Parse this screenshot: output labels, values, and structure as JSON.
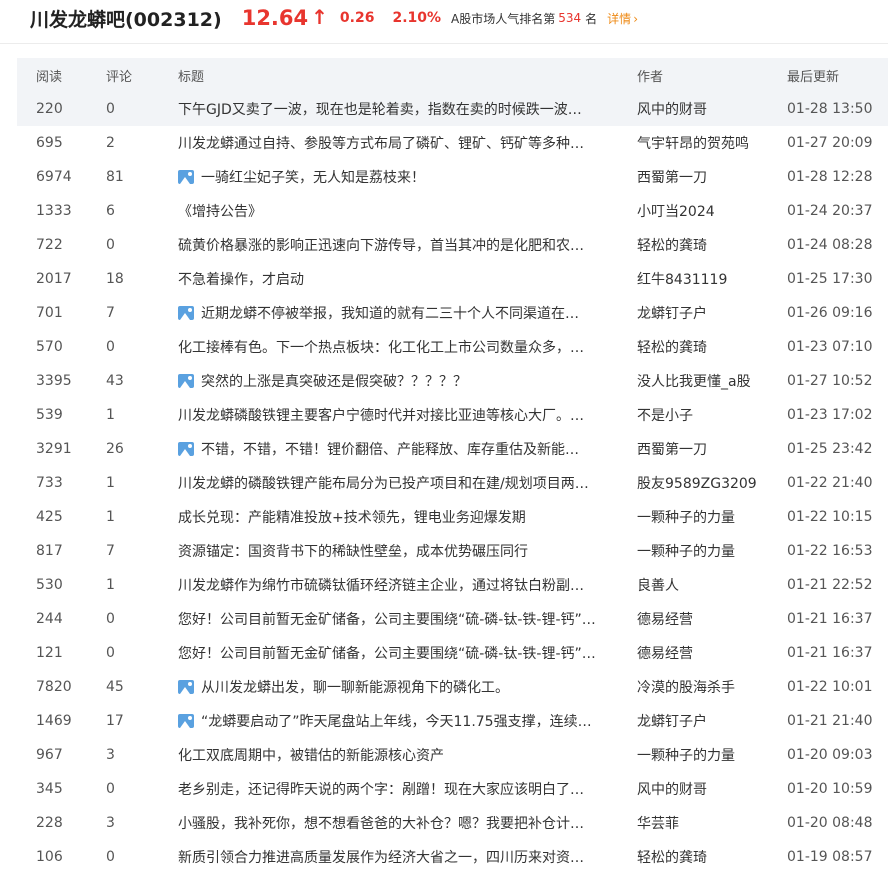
{
  "header": {
    "bar_name": "川发龙蟒吧(002312)",
    "price": "12.64",
    "arrow": "↑",
    "change": "0.26",
    "change_pct": "2.10%",
    "rank_label": "A股市场人气排名第",
    "rank_num": "534",
    "rank_unit": "名",
    "detail": "详情",
    "detail_arrow": "›"
  },
  "columns": {
    "read": "阅读",
    "comments": "评论",
    "title": "标题",
    "author": "作者",
    "updated": "最后更新"
  },
  "posts": [
    {
      "read": "220",
      "comments": "0",
      "img": false,
      "title": "下午GJD又卖了一波，现在也是轮着卖，指数在卖的时候跌一波…",
      "author": "风中的财哥",
      "time": "01-28 13:50"
    },
    {
      "read": "695",
      "comments": "2",
      "img": false,
      "title": "川发龙蟒通过自持、参股等方式布局了磷矿、锂矿、钙矿等多种…",
      "author": "气宇轩昂的贺苑鸣",
      "time": "01-27 20:09"
    },
    {
      "read": "6974",
      "comments": "81",
      "img": true,
      "title": "一骑红尘妃子笑，无人知是荔枝来！",
      "author": "西蜀第一刀",
      "time": "01-28 12:28"
    },
    {
      "read": "1333",
      "comments": "6",
      "img": false,
      "title": "《增持公告》",
      "author": "小叮当2024",
      "time": "01-24 20:37"
    },
    {
      "read": "722",
      "comments": "0",
      "img": false,
      "title": "硫黄价格暴涨的影响正迅速向下游传导，首当其冲的是化肥和农…",
      "author": "轻松的龚琦",
      "time": "01-24 08:28"
    },
    {
      "read": "2017",
      "comments": "18",
      "img": false,
      "title": "不急着操作，才启动",
      "author": "红牛8431119",
      "time": "01-25 17:30"
    },
    {
      "read": "701",
      "comments": "7",
      "img": true,
      "title": "近期龙蟒不停被举报，我知道的就有二三十个人不同渠道在…",
      "author": "龙蟒钉子户",
      "time": "01-26 09:16"
    },
    {
      "read": "570",
      "comments": "0",
      "img": false,
      "title": "化工接棒有色。下一个热点板块：化工化工上市公司数量众多，…",
      "author": "轻松的龚琦",
      "time": "01-23 07:10"
    },
    {
      "read": "3395",
      "comments": "43",
      "img": true,
      "title": "突然的上涨是真突破还是假突破？？？？？",
      "author": "没人比我更懂_a股",
      "time": "01-27 10:52"
    },
    {
      "read": "539",
      "comments": "1",
      "img": false,
      "title": "川发龙蟒磷酸铁锂主要客户宁德时代并对接比亚迪等核心大厂。…",
      "author": "不是小子",
      "time": "01-23 17:02"
    },
    {
      "read": "3291",
      "comments": "26",
      "img": true,
      "title": "不错，不错，不错！锂价翻倍、产能释放、库存重估及新能…",
      "author": "西蜀第一刀",
      "time": "01-25 23:42"
    },
    {
      "read": "733",
      "comments": "1",
      "img": false,
      "title": "川发龙蟒的磷酸铁锂产能布局分为已投产项目和在建/规划项目两…",
      "author": "股友9589ZG3209",
      "time": "01-22 21:40"
    },
    {
      "read": "425",
      "comments": "1",
      "img": false,
      "title": "成长兑现：产能精准投放+技术领先，锂电业务迎爆发期",
      "author": "一颗种子的力量",
      "time": "01-22 10:15"
    },
    {
      "read": "817",
      "comments": "7",
      "img": false,
      "title": "资源锚定：国资背书下的稀缺性壁垒，成本优势碾压同行",
      "author": "一颗种子的力量",
      "time": "01-22 16:53"
    },
    {
      "read": "530",
      "comments": "1",
      "img": false,
      "title": "川发龙蟒作为绵竹市硫磷钛循环经济链主企业，通过将钛白粉副…",
      "author": "良善人",
      "time": "01-21 22:52"
    },
    {
      "read": "244",
      "comments": "0",
      "img": false,
      "title": "您好！公司目前暂无金矿储备，公司主要围绕“硫-磷-钛-铁-锂-钙”…",
      "author": "德易经营",
      "time": "01-21 16:37"
    },
    {
      "read": "121",
      "comments": "0",
      "img": false,
      "title": "您好！公司目前暂无金矿储备，公司主要围绕“硫-磷-钛-铁-锂-钙”…",
      "author": "德易经营",
      "time": "01-21 16:37"
    },
    {
      "read": "7820",
      "comments": "45",
      "img": true,
      "title": "从川发龙蟒出发，聊一聊新能源视角下的磷化工。",
      "author": "冷漠的股海杀手",
      "time": "01-22 10:01"
    },
    {
      "read": "1469",
      "comments": "17",
      "img": true,
      "title": "“龙蟒要启动了”昨天尾盘站上年线，今天11.75强支撑，连续…",
      "author": "龙蟒钉子户",
      "time": "01-21 21:40"
    },
    {
      "read": "967",
      "comments": "3",
      "img": false,
      "title": "化工双底周期中，被错估的新能源核心资产",
      "author": "一颗种子的力量",
      "time": "01-20 09:03"
    },
    {
      "read": "345",
      "comments": "0",
      "img": false,
      "title": "老乡别走，还记得昨天说的两个字：剐蹭！现在大家应该明白了…",
      "author": "风中的财哥",
      "time": "01-20 10:59"
    },
    {
      "read": "228",
      "comments": "3",
      "img": false,
      "title": "小骚股，我补死你，想不想看爸爸的大补仓？嗯？我要把补仓计…",
      "author": "华芸菲",
      "time": "01-20 08:48"
    },
    {
      "read": "106",
      "comments": "0",
      "img": false,
      "title": "新质引领合力推进高质量发展作为经济大省之一，四川历来对资…",
      "author": "轻松的龚琦",
      "time": "01-19 08:57"
    }
  ],
  "colors": {
    "up_red": "#e8352e",
    "detail_orange": "#ee8a16",
    "header_bg": "#f2f4f7",
    "image_icon_blue": "#5aa1e0"
  },
  "icons": {
    "image_icon": "image-icon",
    "up_arrow": "up-arrow-icon"
  }
}
